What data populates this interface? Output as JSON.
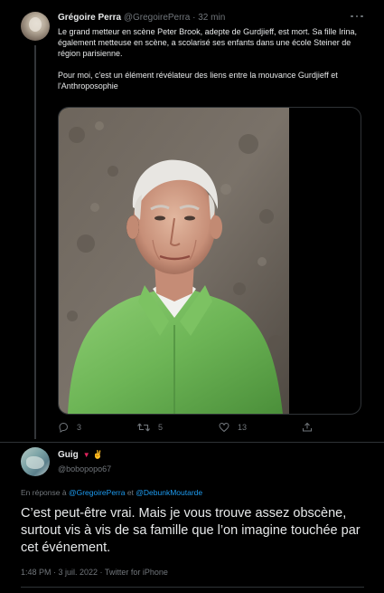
{
  "tweet": {
    "author_name": "Grégoire Perra",
    "author_handle": "@GregoirePerra",
    "separator": "·",
    "time": "32 min",
    "paragraph1": "Le grand metteur en scène Peter Brook, adepte de Gurdjieff, est mort. Sa fille Irina, également metteuse en scène, a scolarisé ses enfants dans une école Steiner de région parisienne.",
    "paragraph2": "Pour moi, c'est un élément révélateur des liens entre la mouvance Gurdjieff et l'Anthroposophie",
    "replies": "3",
    "retweets": "5",
    "likes": "13",
    "icons": [
      "more-icon",
      "reply-icon",
      "retweet-icon",
      "like-icon",
      "share-icon"
    ]
  },
  "reply": {
    "author_name": "Guig",
    "author_emojis": [
      "red-heart",
      "victory-hand"
    ],
    "author_handle": "@bobopopo67",
    "reply_prefix": "En réponse à",
    "mention1": "@GregoirePerra",
    "conjunction": "et",
    "mention2": "@DebunkMoutarde",
    "text": "C’est peut-être vrai. Mais je vous trouve assez obscène, surtout vis à vis de sa famille que l’on imagine touchée par cet événement.",
    "meta": "1:48 PM · 3 juil. 2022 · Twitter for iPhone"
  },
  "colors": {
    "background": "#000000",
    "text": "#e7e9ea",
    "secondary": "#71767b",
    "link": "#1d9bf0",
    "border": "#2f3336"
  }
}
